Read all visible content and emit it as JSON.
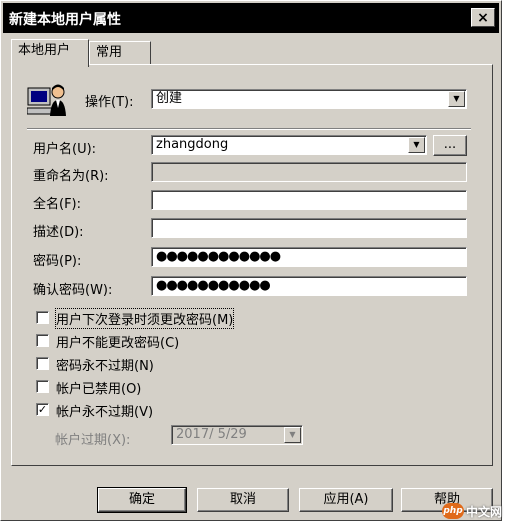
{
  "window": {
    "title": "新建本地用户属性",
    "close_label": "×"
  },
  "tabs": [
    {
      "label": "本地用户",
      "active": true
    },
    {
      "label": "常用",
      "active": false
    }
  ],
  "operation": {
    "label": "操作(T):",
    "value": "创建"
  },
  "form": {
    "username": {
      "label": "用户名(U):",
      "value": "zhangdong",
      "browse_label": "..."
    },
    "rename": {
      "label": "重命名为(R):",
      "value": ""
    },
    "fullname": {
      "label": "全名(F):",
      "value": ""
    },
    "description": {
      "label": "描述(D):",
      "value": ""
    },
    "password": {
      "label": "密码(P):",
      "value": "●●●●●●●●●●●●"
    },
    "confirm_password": {
      "label": "确认密码(W):",
      "value": "●●●●●●●●●●●"
    }
  },
  "options": [
    {
      "label": "用户下次登录时须更改密码(M)",
      "checked": false,
      "mark": ""
    },
    {
      "label": "用户不能更改密码(C)",
      "checked": false,
      "mark": ""
    },
    {
      "label": "密码永不过期(N)",
      "checked": false,
      "mark": ""
    },
    {
      "label": "帐户已禁用(O)",
      "checked": false,
      "mark": ""
    },
    {
      "label": "帐户永不过期(V)",
      "checked": true,
      "mark": "✓"
    }
  ],
  "expiry": {
    "label": "帐户过期(X):",
    "value": "2017/ 5/29"
  },
  "buttons": {
    "ok": "确定",
    "cancel": "取消",
    "apply": "应用(A)",
    "help": "帮助"
  },
  "watermark": {
    "badge": "php",
    "text": "中文网"
  }
}
